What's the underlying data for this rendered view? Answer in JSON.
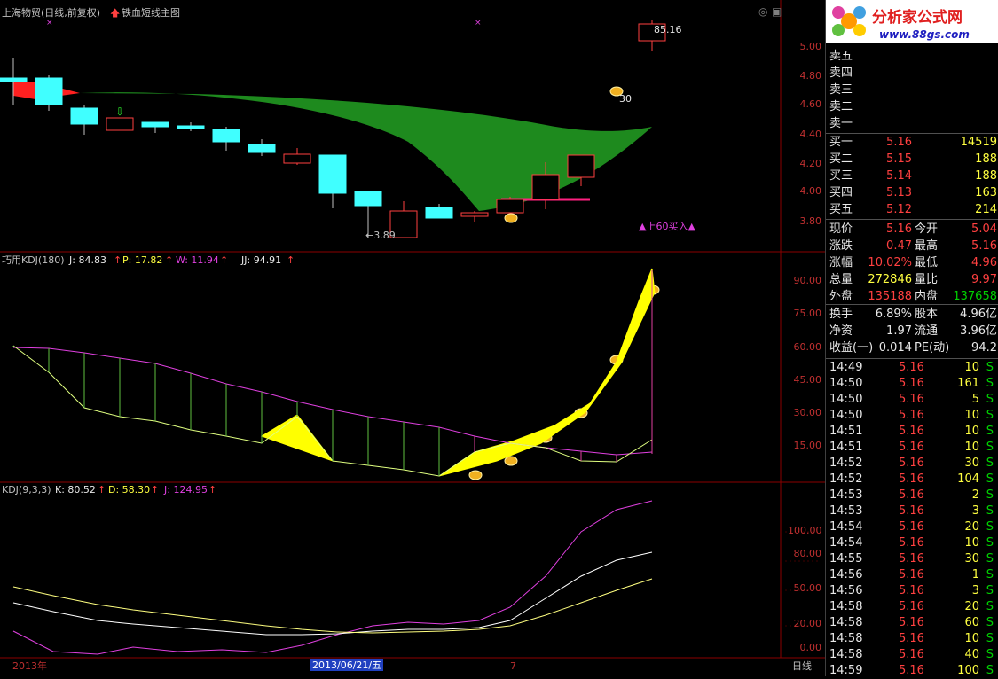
{
  "main_panel": {
    "stock_title": "上海物贸(日线,前复权)",
    "indicator_name": "铁血短线主图",
    "high_label": "5.16",
    "high_prefix": "8",
    "low_label": "←3.89",
    "price_tag_label": "30",
    "buy_signal": "▲上60买入▲",
    "y_ticks": [
      "5.00",
      "4.80",
      "4.60",
      "4.40",
      "4.20",
      "4.00",
      "3.80"
    ]
  },
  "kdj180_panel": {
    "title": "巧用KDJ(180)",
    "j": "J: 84.83",
    "p": "P: 17.82",
    "w": "W: 11.94",
    "jj": "JJ: 94.91",
    "y_ticks": [
      "90.00",
      "75.00",
      "60.00",
      "45.00",
      "30.00",
      "15.00"
    ]
  },
  "kdj_panel": {
    "title": "KDJ(9,3,3)",
    "k": "K: 80.52",
    "d": "D: 58.30",
    "j": "J: 124.95",
    "y_ticks": [
      "100.00",
      "80.00",
      "50.00",
      "20.00",
      "0.00"
    ]
  },
  "time_axis": {
    "year": "2013年",
    "cursor_date": "2013/06/21/五",
    "month": "7",
    "period": "日线"
  },
  "logo": {
    "name": "分析家公式网",
    "url": "www.88gs.com"
  },
  "order_book": {
    "sells": [
      {
        "label": "卖五",
        "price": "",
        "vol": ""
      },
      {
        "label": "卖四",
        "price": "",
        "vol": ""
      },
      {
        "label": "卖三",
        "price": "",
        "vol": ""
      },
      {
        "label": "卖二",
        "price": "",
        "vol": ""
      },
      {
        "label": "卖一",
        "price": "",
        "vol": ""
      }
    ],
    "buys": [
      {
        "label": "买一",
        "price": "5.16",
        "vol": "14519"
      },
      {
        "label": "买二",
        "price": "5.15",
        "vol": "188"
      },
      {
        "label": "买三",
        "price": "5.14",
        "vol": "188"
      },
      {
        "label": "买四",
        "price": "5.13",
        "vol": "163"
      },
      {
        "label": "买五",
        "price": "5.12",
        "vol": "214"
      }
    ]
  },
  "quote": {
    "rows": [
      {
        "l1": "现价",
        "v1": "5.16",
        "l2": "今开",
        "v2": "5.04"
      },
      {
        "l1": "涨跌",
        "v1": "0.47",
        "l2": "最高",
        "v2": "5.16"
      },
      {
        "l1": "涨幅",
        "v1": "10.02%",
        "l2": "最低",
        "v2": "4.96"
      },
      {
        "l1": "总量",
        "v1": "272846",
        "l2": "量比",
        "v2": "9.97"
      },
      {
        "l1": "外盘",
        "v1": "135188",
        "l2": "内盘",
        "v2": "137658"
      }
    ],
    "rows2": [
      {
        "l1": "换手",
        "v1": "6.89%",
        "l2": "股本",
        "v2": "4.96亿"
      },
      {
        "l1": "净资",
        "v1": "1.97",
        "l2": "流通",
        "v2": "3.96亿"
      },
      {
        "l1": "收益(一)",
        "v1": "0.014",
        "l2": "PE(动)",
        "v2": "94.2"
      }
    ]
  },
  "ticks": [
    {
      "time": "14:49",
      "price": "5.16",
      "vol": "10",
      "side": "S"
    },
    {
      "time": "14:50",
      "price": "5.16",
      "vol": "161",
      "side": "S"
    },
    {
      "time": "14:50",
      "price": "5.16",
      "vol": "5",
      "side": "S"
    },
    {
      "time": "14:50",
      "price": "5.16",
      "vol": "10",
      "side": "S"
    },
    {
      "time": "14:51",
      "price": "5.16",
      "vol": "10",
      "side": "S"
    },
    {
      "time": "14:51",
      "price": "5.16",
      "vol": "10",
      "side": "S"
    },
    {
      "time": "14:52",
      "price": "5.16",
      "vol": "30",
      "side": "S"
    },
    {
      "time": "14:52",
      "price": "5.16",
      "vol": "104",
      "side": "S"
    },
    {
      "time": "14:53",
      "price": "5.16",
      "vol": "2",
      "side": "S"
    },
    {
      "time": "14:53",
      "price": "5.16",
      "vol": "3",
      "side": "S"
    },
    {
      "time": "14:54",
      "price": "5.16",
      "vol": "20",
      "side": "S"
    },
    {
      "time": "14:54",
      "price": "5.16",
      "vol": "10",
      "side": "S"
    },
    {
      "time": "14:55",
      "price": "5.16",
      "vol": "30",
      "side": "S"
    },
    {
      "time": "14:56",
      "price": "5.16",
      "vol": "1",
      "side": "S"
    },
    {
      "time": "14:56",
      "price": "5.16",
      "vol": "3",
      "side": "S"
    },
    {
      "time": "14:58",
      "price": "5.16",
      "vol": "20",
      "side": "S"
    },
    {
      "time": "14:58",
      "price": "5.16",
      "vol": "60",
      "side": "S"
    },
    {
      "time": "14:58",
      "price": "5.16",
      "vol": "10",
      "side": "S"
    },
    {
      "time": "14:58",
      "price": "5.16",
      "vol": "40",
      "side": "S"
    },
    {
      "time": "14:59",
      "price": "5.16",
      "vol": "100",
      "side": "S"
    }
  ],
  "colors": {
    "up": "#ff4040",
    "down": "#40ffff",
    "ribbon": "#1e8a1e",
    "kdj_j": "#e040e0",
    "kdj_k": "#ffffff",
    "kdj_d": "#ffff80",
    "fill_yellow": "#ffff00"
  }
}
